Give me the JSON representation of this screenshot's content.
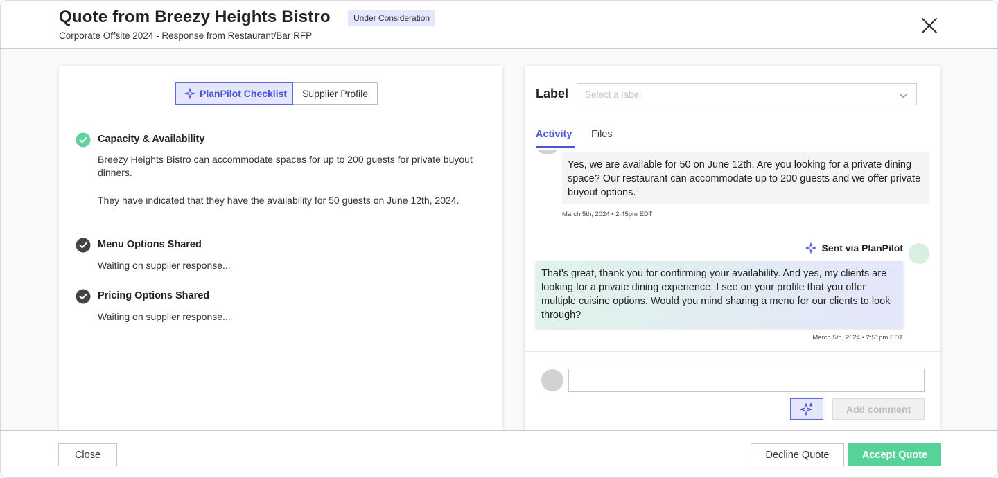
{
  "header": {
    "title": "Quote from Breezy Heights Bistro",
    "status": "Under Consideration",
    "subtitle": "Corporate Offsite 2024 - Response from Restaurant/Bar RFP",
    "close_icon": "close-icon"
  },
  "left_panel": {
    "toggle": {
      "active_label": "PlanPilot Checklist",
      "inactive_label": "Supplier Profile",
      "active_icon": "sparkle-icon"
    },
    "checklist": [
      {
        "title": "Capacity & Availability",
        "status": "complete",
        "status_color": "#5ed49c",
        "paragraphs": [
          "Breezy Heights Bistro can accommodate spaces for up to 200 guests for private buyout dinners.",
          "They have indicated that they have the availability for 50 guests on June 12th, 2024."
        ]
      },
      {
        "title": "Menu Options Shared",
        "status": "pending",
        "status_color": "#454545",
        "paragraphs": [
          "Waiting on supplier response..."
        ]
      },
      {
        "title": "Pricing Options Shared",
        "status": "pending",
        "status_color": "#454545",
        "paragraphs": [
          "Waiting on supplier response..."
        ]
      }
    ]
  },
  "right_panel": {
    "label_title": "Label",
    "label_placeholder": "Select a label",
    "tabs": [
      {
        "label": "Activity",
        "active": true
      },
      {
        "label": "Files",
        "active": false
      }
    ],
    "messages": [
      {
        "direction": "incoming",
        "text": "Yes, we are available for 50 on June 12th. Are you looking for a private dining space? Our restaurant can accommodate up to 200 guests and we offer private buyout options.",
        "timestamp": "March 5th, 2024 • 2:45pm EDT"
      },
      {
        "direction": "outgoing",
        "sent_via": "Sent via PlanPilot",
        "text": "That's great, thank you for confirming your availability. And yes, my clients are looking for a private dining experience. I see on your profile that you offer multiple cuisine options. Would you mind sharing a menu for our clients to look through?",
        "timestamp": "March 5th, 2024 • 2:51pm EDT"
      }
    ],
    "compose": {
      "input_value": "",
      "ai_icon": "sparkle-icon",
      "add_comment_label": "Add comment"
    }
  },
  "footer": {
    "close_label": "Close",
    "decline_label": "Decline Quote",
    "accept_label": "Accept Quote"
  },
  "colors": {
    "accent": "#4a55d6",
    "accent_light": "#e4e6fb",
    "success": "#57d39a"
  }
}
